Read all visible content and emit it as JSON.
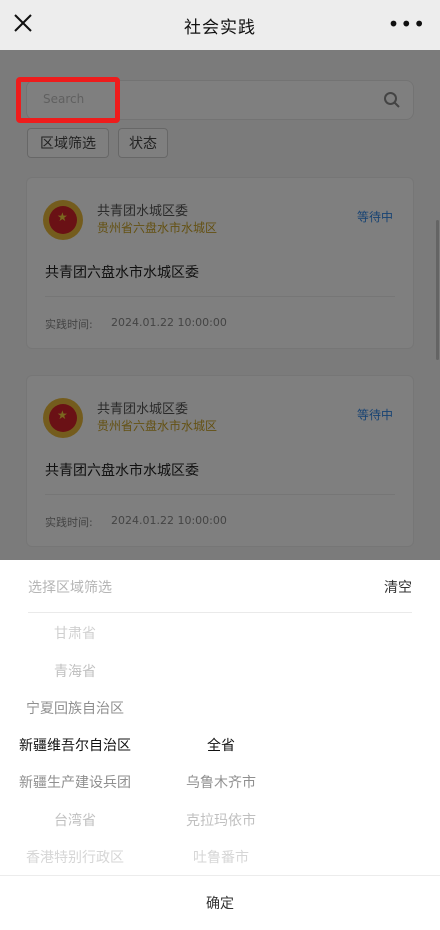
{
  "header": {
    "title": "社会实践",
    "close_icon": "close-icon",
    "more_icon": "more-icon",
    "more_glyph": "•••"
  },
  "search": {
    "placeholder": "Search",
    "icon": "search-icon"
  },
  "filters": {
    "region_label": "区域筛选",
    "status_label": "状态"
  },
  "cards": [
    {
      "org": "共青团水城区委",
      "region": "贵州省六盘水市水城区",
      "status": "等待中",
      "name": "共青团六盘水市水城区委",
      "time_label": "实践时间:",
      "time_value": "2024.01.22 10:00:00"
    },
    {
      "org": "共青团水城区委",
      "region": "贵州省六盘水市水城区",
      "status": "等待中",
      "name": "共青团六盘水市水城区委",
      "time_label": "实践时间:",
      "time_value": "2024.01.22 10:00:00"
    }
  ],
  "sheet": {
    "title": "选择区域筛选",
    "clear_label": "清空",
    "provinces": [
      "甘肃省",
      "青海省",
      "宁夏回族自治区",
      "新疆维吾尔自治区",
      "新疆生产建设兵团",
      "台湾省",
      "香港特别行政区"
    ],
    "cities": [
      "全省",
      "乌鲁木齐市",
      "克拉玛依市",
      "吐鲁番市"
    ],
    "selected_province": "新疆维吾尔自治区",
    "selected_city": "全省",
    "confirm_label": "确定"
  },
  "colors": {
    "highlight": "#ee1c1c",
    "status_blue": "#2f86e6",
    "region_gold": "#c9a227"
  }
}
